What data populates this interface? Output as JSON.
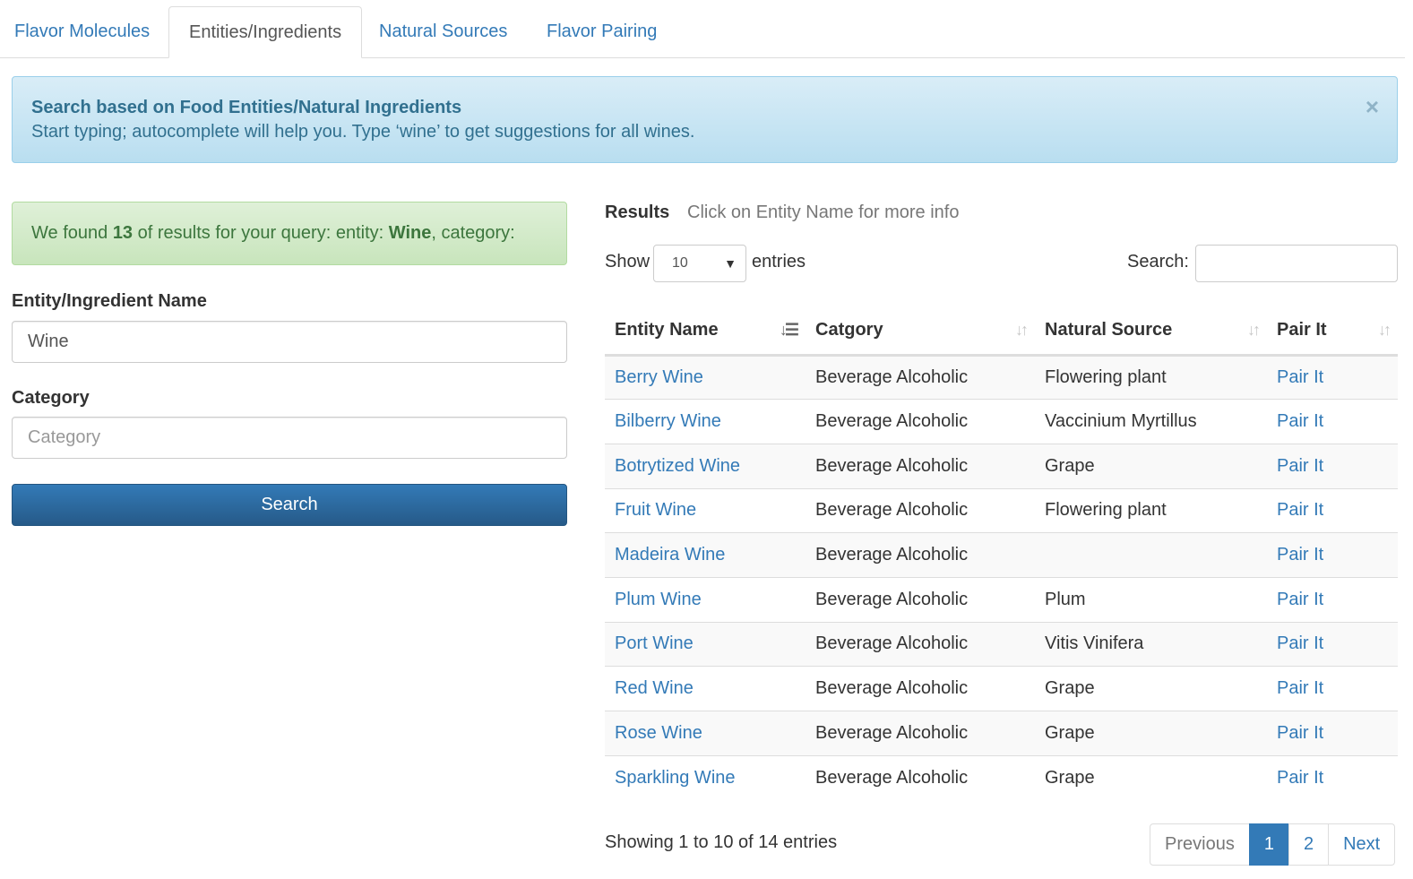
{
  "tabs": [
    {
      "label": "Flavor Molecules",
      "active": false
    },
    {
      "label": "Entities/Ingredients",
      "active": true
    },
    {
      "label": "Natural Sources",
      "active": false
    },
    {
      "label": "Flavor Pairing",
      "active": false
    }
  ],
  "info_alert": {
    "title": "Search based on Food Entities/Natural Ingredients",
    "text": "Start typing; autocomplete will help you. Type ‘wine’ to get suggestions for all wines.",
    "close_icon": "×"
  },
  "success_alert": {
    "prefix": "We found ",
    "count": "13",
    "middle": " of results for your query: entity: ",
    "entity": "Wine",
    "suffix": ", category:"
  },
  "form": {
    "entity_label": "Entity/Ingredient Name",
    "entity_value": "Wine",
    "category_label": "Category",
    "category_placeholder": "Category",
    "search_button": "Search"
  },
  "results": {
    "title": "Results",
    "hint": "Click on Entity Name for more info",
    "show_label": "Show",
    "length_value": "10",
    "entries_label": "entries",
    "search_label": "Search:",
    "columns": [
      "Entity Name",
      "Catgory",
      "Natural Source",
      "Pair It"
    ],
    "rows": [
      {
        "name": "Berry Wine",
        "category": "Beverage Alcoholic",
        "source": "Flowering plant",
        "pair": "Pair It"
      },
      {
        "name": "Bilberry Wine",
        "category": "Beverage Alcoholic",
        "source": "Vaccinium Myrtillus",
        "pair": "Pair It"
      },
      {
        "name": "Botrytized Wine",
        "category": "Beverage Alcoholic",
        "source": "Grape",
        "pair": "Pair It"
      },
      {
        "name": "Fruit Wine",
        "category": "Beverage Alcoholic",
        "source": "Flowering plant",
        "pair": "Pair It"
      },
      {
        "name": "Madeira Wine",
        "category": "Beverage Alcoholic",
        "source": "",
        "pair": "Pair It"
      },
      {
        "name": "Plum Wine",
        "category": "Beverage Alcoholic",
        "source": "Plum",
        "pair": "Pair It"
      },
      {
        "name": "Port Wine",
        "category": "Beverage Alcoholic",
        "source": "Vitis Vinifera",
        "pair": "Pair It"
      },
      {
        "name": "Red Wine",
        "category": "Beverage Alcoholic",
        "source": "Grape",
        "pair": "Pair It"
      },
      {
        "name": "Rose Wine",
        "category": "Beverage Alcoholic",
        "source": "Grape",
        "pair": "Pair It"
      },
      {
        "name": "Sparkling Wine",
        "category": "Beverage Alcoholic",
        "source": "Grape",
        "pair": "Pair It"
      }
    ],
    "info": "Showing 1 to 10 of 14 entries"
  },
  "pagination": {
    "previous": "Previous",
    "pages": [
      "1",
      "2"
    ],
    "current_page": "1",
    "next": "Next"
  }
}
